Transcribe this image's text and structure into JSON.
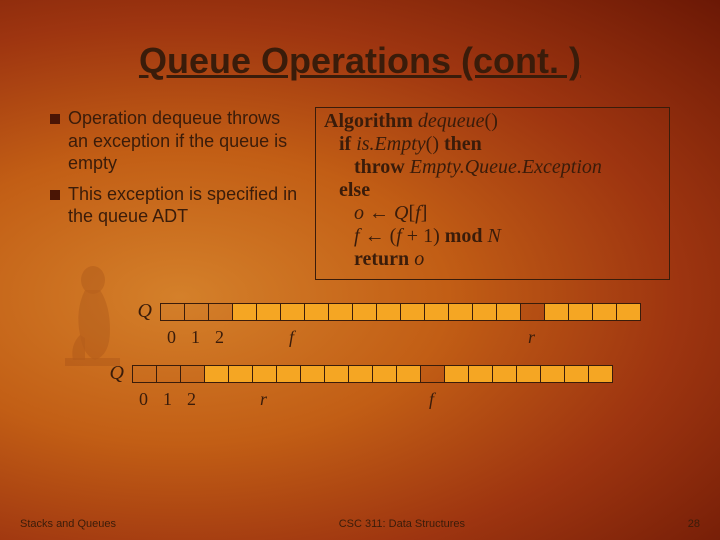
{
  "title": "Queue Operations (cont. )",
  "bullets": [
    "Operation dequeue throws an exception if the queue is empty",
    "This exception is specified in the queue ADT"
  ],
  "algorithm": {
    "l1a": "Algorithm",
    "l1b": " dequeue",
    "l1c": "()",
    "l2a": "   if",
    "l2b": " is.Empty",
    "l2c": "() ",
    "l2d": "then",
    "l3a": "      throw",
    "l3b": " Empty.Queue.Exception",
    "l4": "   else",
    "l5a": "      o ",
    "l5arrow": "←",
    "l5b": " Q",
    "l5c": "[",
    "l5d": "f",
    "l5e": "]",
    "l6a": "      f ",
    "l6arrow": "←",
    "l6b": " (",
    "l6c": "f ",
    "l6d": "+ 1) ",
    "l6e": "mod",
    "l6f": " N",
    "l7a": "      return",
    "l7b": " o"
  },
  "array_label": "Q",
  "indices": {
    "i0": "0",
    "i1": "1",
    "i2": "2",
    "f": "f",
    "r": "r"
  },
  "footer": {
    "left": "Stacks and Queues",
    "center": "CSC 311: Data Structures",
    "right": "28"
  }
}
